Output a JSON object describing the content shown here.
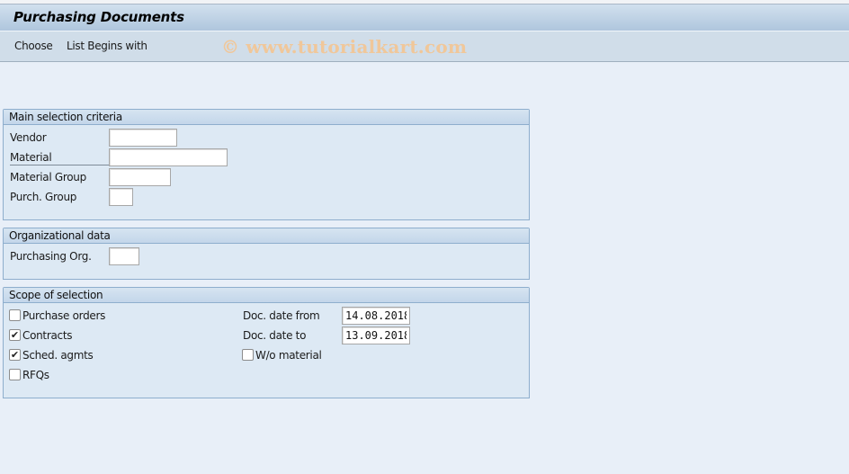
{
  "window": {
    "title": "Purchasing Documents"
  },
  "toolbar": {
    "items": [
      {
        "label": "Choose"
      },
      {
        "label": "List Begins with"
      }
    ],
    "watermark": "© www.tutorialkart.com"
  },
  "main_selection": {
    "header": "Main selection criteria",
    "fields": [
      {
        "label": "Vendor",
        "value": ""
      },
      {
        "label": "Material",
        "value": ""
      },
      {
        "label": "Material Group",
        "value": ""
      },
      {
        "label": "Purch. Group",
        "value": ""
      }
    ]
  },
  "org_data": {
    "header": "Organizational data",
    "fields": [
      {
        "label": "Purchasing Org.",
        "value": ""
      }
    ]
  },
  "scope": {
    "header": "Scope of selection",
    "checkboxes": [
      {
        "label": "Purchase orders",
        "checked": false
      },
      {
        "label": "Contracts",
        "checked": true
      },
      {
        "label": "Sched. agmts",
        "checked": true
      },
      {
        "label": "RFQs",
        "checked": false
      }
    ],
    "date_from": {
      "label": "Doc. date from",
      "value": "14.08.2018"
    },
    "date_to": {
      "label": "Doc. date to",
      "value": "13.09.2018"
    },
    "wo_material": {
      "label": "W/o material",
      "checked": false
    }
  },
  "colors": {
    "background": "#e8eff8",
    "groupbox_border": "#8eaecd",
    "watermark": "#f0c79a"
  }
}
